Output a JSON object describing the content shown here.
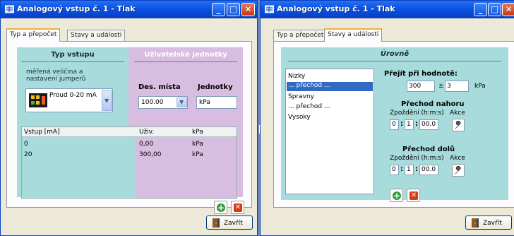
{
  "left_window": {
    "title": "Analogový vstup č. 1 - Tlak",
    "tabs": [
      {
        "label": "Typ a přepočet",
        "active": true
      },
      {
        "label": "Stavy a události",
        "active": false
      }
    ],
    "input_type": {
      "title": "Typ vstupu",
      "description": "měřená veličina a nastavení jumperů",
      "selected": "Proud 0-20 mA"
    },
    "user_units": {
      "title": "Uživatelské jednotky",
      "decimals_label": "Des. místa",
      "decimals_value": "100.00",
      "units_label": "Jednotky",
      "units_value": "kPa"
    },
    "table": {
      "columns": [
        "Vstup [mA]",
        "Uživ.",
        "kPa"
      ],
      "rows": [
        [
          "0",
          "0,00",
          "kPa"
        ],
        [
          "20",
          "300,00",
          "kPa"
        ]
      ]
    },
    "close_label": "Zavřít"
  },
  "right_window": {
    "title": "Analogový vstup č. 1 - Tlak",
    "tabs": [
      {
        "label": "Typ a přepočet",
        "active": false
      },
      {
        "label": "Stavy a události",
        "active": true
      }
    ],
    "levels_title": "Úrovně",
    "levels": [
      {
        "label": "Nizky",
        "selected": false
      },
      {
        "label": "... přechod ...",
        "selected": true
      },
      {
        "label": "Spravny",
        "selected": false
      },
      {
        "label": "... přechod ...",
        "selected": false
      },
      {
        "label": "Vysoky",
        "selected": false
      }
    ],
    "threshold": {
      "label": "Přejít při hodnotě:",
      "value": "300",
      "pm": "±",
      "tolerance": "3",
      "unit": "kPa"
    },
    "transition_up": {
      "title": "Přechod nahoru",
      "delay_label": "Zpoždění (h:m:s)",
      "action_label": "Akce",
      "h": "0",
      "m": "1",
      "s": "00.0"
    },
    "transition_down": {
      "title": "Přechod dolů",
      "delay_label": "Zpoždění (h:m:s)",
      "action_label": "Akce",
      "h": "0",
      "m": "1",
      "s": "00.0"
    },
    "close_label": "Zavřít"
  },
  "colors": {
    "titlebar": "#0a56e6",
    "cyan_panel": "#a8dcdc",
    "lilac_panel": "#d7bddf",
    "selection": "#316ac5"
  },
  "icons": [
    "window-app-icon",
    "minimize-icon",
    "maximize-icon",
    "close-icon",
    "chevron-down-icon",
    "circuit-chip-icon",
    "plus-icon",
    "delete-icon",
    "door-exit-icon",
    "wrench-icon"
  ]
}
